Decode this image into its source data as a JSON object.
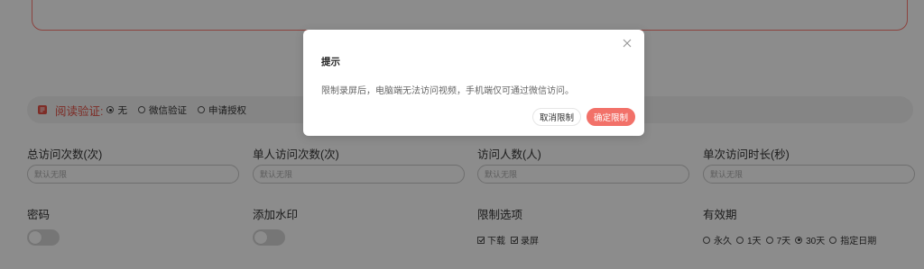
{
  "verify": {
    "title": "阅读验证:",
    "options": [
      {
        "label": "无",
        "selected": true
      },
      {
        "label": "微信验证",
        "selected": false
      },
      {
        "label": "申请授权",
        "selected": false
      }
    ]
  },
  "fields": {
    "total_visits": {
      "label": "总访问次数(次)",
      "placeholder": "默认无限"
    },
    "single_visits": {
      "label": "单人访问次数(次)",
      "placeholder": "默认无限"
    },
    "visitors": {
      "label": "访问人数(人)",
      "placeholder": "默认无限"
    },
    "duration": {
      "label": "单次访问时长(秒)",
      "placeholder": "默认无限"
    },
    "password": {
      "label": "密码",
      "enabled": false
    },
    "watermark": {
      "label": "添加水印",
      "enabled": false
    },
    "limits": {
      "label": "限制选项",
      "options": [
        {
          "label": "下载",
          "checked": true
        },
        {
          "label": "录屏",
          "checked": true
        }
      ]
    },
    "validity": {
      "label": "有效期",
      "options": [
        {
          "label": "永久",
          "selected": false
        },
        {
          "label": "1天",
          "selected": false
        },
        {
          "label": "7天",
          "selected": false
        },
        {
          "label": "30天",
          "selected": true
        },
        {
          "label": "指定日期",
          "selected": false
        }
      ]
    }
  },
  "dialog": {
    "title": "提示",
    "message": "限制录屏后，电脑端无法访问视频，手机端仅可通过微信访问。",
    "cancel_label": "取消限制",
    "confirm_label": "确定限制"
  },
  "colors": {
    "accent": "#f27169",
    "title_red": "#e55347",
    "overlay": "rgba(0,0,0,0.45)"
  }
}
